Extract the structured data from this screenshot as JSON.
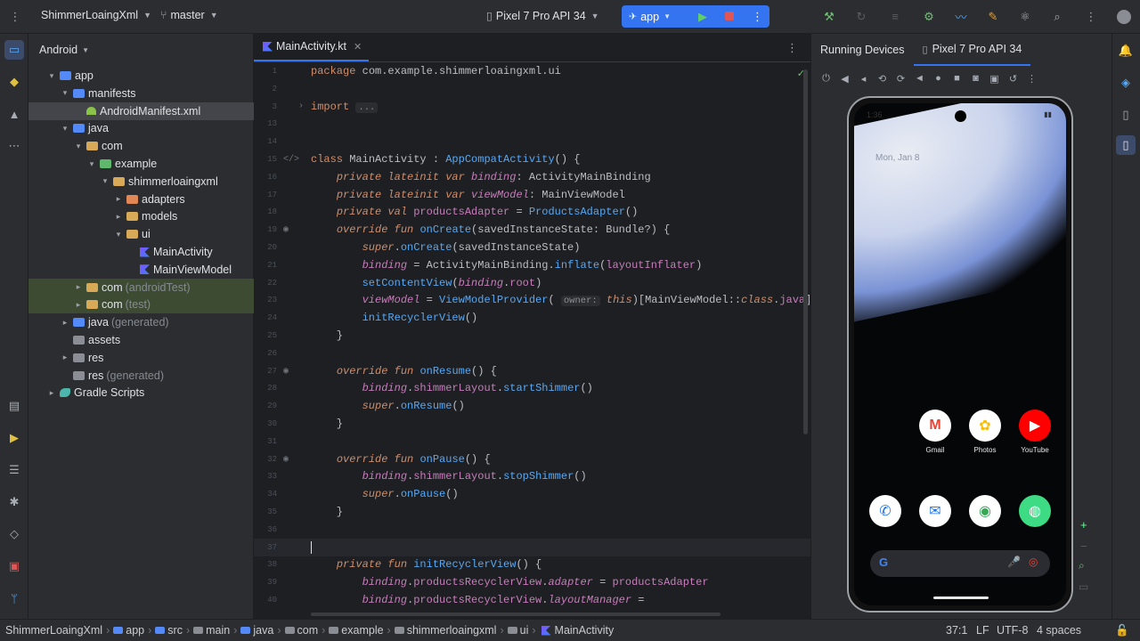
{
  "toolbar": {
    "project_name": "ShimmerLoaingXml",
    "branch": "master",
    "device": "Pixel 7 Pro API 34",
    "run_config": "app"
  },
  "project": {
    "view_mode": "Android",
    "tree": [
      {
        "label": "app",
        "extra": "",
        "depth": 1,
        "icon": "folder-blue",
        "caret": "▾"
      },
      {
        "label": "manifests",
        "extra": "",
        "depth": 2,
        "icon": "folder-blue",
        "caret": "▾"
      },
      {
        "label": "AndroidManifest.xml",
        "extra": "",
        "depth": 3,
        "icon": "android",
        "caret": ""
      },
      {
        "label": "java",
        "extra": "",
        "depth": 2,
        "icon": "folder-blue",
        "caret": "▾"
      },
      {
        "label": "com",
        "extra": "",
        "depth": 3,
        "icon": "folder",
        "caret": "▾"
      },
      {
        "label": "example",
        "extra": "",
        "depth": 4,
        "icon": "folder-green",
        "caret": "▾"
      },
      {
        "label": "shimmerloaingxml",
        "extra": "",
        "depth": 5,
        "icon": "folder",
        "caret": "▾"
      },
      {
        "label": "adapters",
        "extra": "",
        "depth": 6,
        "icon": "folder-orange",
        "caret": "▸"
      },
      {
        "label": "models",
        "extra": "",
        "depth": 6,
        "icon": "folder",
        "caret": "▸"
      },
      {
        "label": "ui",
        "extra": "",
        "depth": 6,
        "icon": "folder",
        "caret": "▾"
      },
      {
        "label": "MainActivity",
        "extra": "",
        "depth": 7,
        "icon": "kt",
        "caret": ""
      },
      {
        "label": "MainViewModel",
        "extra": "",
        "depth": 7,
        "icon": "kt",
        "caret": ""
      },
      {
        "label": "com",
        "extra": "(androidTest)",
        "depth": 3,
        "icon": "folder",
        "caret": "▸"
      },
      {
        "label": "com",
        "extra": "(test)",
        "depth": 3,
        "icon": "folder",
        "caret": "▸"
      },
      {
        "label": "java",
        "extra": "(generated)",
        "depth": 2,
        "icon": "folder-blue",
        "caret": "▸"
      },
      {
        "label": "assets",
        "extra": "",
        "depth": 2,
        "icon": "folder-gray",
        "caret": ""
      },
      {
        "label": "res",
        "extra": "",
        "depth": 2,
        "icon": "folder-gray",
        "caret": "▸"
      },
      {
        "label": "res",
        "extra": "(generated)",
        "depth": 2,
        "icon": "folder-gray",
        "caret": ""
      },
      {
        "label": "Gradle Scripts",
        "extra": "",
        "depth": 1,
        "icon": "gradle",
        "caret": "▸"
      }
    ]
  },
  "editor": {
    "tab_label": "MainActivity.kt",
    "lines": [
      {
        "n": "1",
        "html": "<span class='k'>package</span> com.example.shimmerloaingxml.ui"
      },
      {
        "n": "2",
        "html": ""
      },
      {
        "n": "3",
        "html": "<span class='k'>import</span> <span class='hint'>...</span>"
      },
      {
        "n": "13",
        "html": ""
      },
      {
        "n": "14",
        "html": ""
      },
      {
        "n": "15",
        "html": "<span class='k'>class</span> MainActivity : <span class='fn'>AppCompatActivity</span>() {"
      },
      {
        "n": "16",
        "html": "    <span class='ki'>private lateinit var</span> <span class='pvi'>binding</span>: ActivityMainBinding"
      },
      {
        "n": "17",
        "html": "    <span class='ki'>private lateinit var</span> <span class='pvi'>viewModel</span>: MainViewModel"
      },
      {
        "n": "18",
        "html": "    <span class='ki'>private val</span> <span class='pv'>productsAdapter</span> = <span class='fn'>ProductsAdapter</span>()"
      },
      {
        "n": "19",
        "html": "    <span class='ki'>override fun</span> <span class='fn'>onCreate</span>(savedInstanceState: Bundle?) {"
      },
      {
        "n": "20",
        "html": "        <span class='ki'>super</span>.<span class='fn'>onCreate</span>(savedInstanceState)"
      },
      {
        "n": "21",
        "html": "        <span class='pvi'>binding</span> = ActivityMainBinding.<span class='fn'>inflate</span>(<span class='pv'>layoutInflater</span>)"
      },
      {
        "n": "22",
        "html": "        <span class='fn'>setContentView</span>(<span class='pvi'>binding</span>.<span class='pv'>root</span>)"
      },
      {
        "n": "23",
        "html": "        <span class='pvi'>viewModel</span> = <span class='fn'>ViewModelProvider</span>( <span class='hint'>owner:</span> <span class='ki'>this</span>)[MainViewModel::<span class='ki'>class</span>.<span class='pv'>java</span>]"
      },
      {
        "n": "24",
        "html": "        <span class='fn'>initRecyclerView</span>()"
      },
      {
        "n": "25",
        "html": "    }"
      },
      {
        "n": "26",
        "html": ""
      },
      {
        "n": "27",
        "html": "    <span class='ki'>override fun</span> <span class='fn'>onResume</span>() {"
      },
      {
        "n": "28",
        "html": "        <span class='pvi'>binding</span>.<span class='pv'>shimmerLayout</span>.<span class='fn'>startShimmer</span>()"
      },
      {
        "n": "29",
        "html": "        <span class='ki'>super</span>.<span class='fn'>onResume</span>()"
      },
      {
        "n": "30",
        "html": "    }"
      },
      {
        "n": "31",
        "html": ""
      },
      {
        "n": "32",
        "html": "    <span class='ki'>override fun</span> <span class='fn'>onPause</span>() {"
      },
      {
        "n": "33",
        "html": "        <span class='pvi'>binding</span>.<span class='pv'>shimmerLayout</span>.<span class='fn'>stopShimmer</span>()"
      },
      {
        "n": "34",
        "html": "        <span class='ki'>super</span>.<span class='fn'>onPause</span>()"
      },
      {
        "n": "35",
        "html": "    }"
      },
      {
        "n": "36",
        "html": ""
      },
      {
        "n": "37",
        "html": ""
      },
      {
        "n": "38",
        "html": "    <span class='ki'>private fun</span> <span class='fn'>initRecyclerView</span>() {"
      },
      {
        "n": "39",
        "html": "        <span class='pvi'>binding</span>.<span class='pv'>productsRecyclerView</span>.<span class='pvi'>adapter</span> = <span class='pv'>productsAdapter</span>"
      },
      {
        "n": "40",
        "html": "        <span class='pvi'>binding</span>.<span class='pv'>productsRecyclerView</span>.<span class='pvi'>layoutManager</span> ="
      }
    ]
  },
  "device_panel": {
    "tab_running": "Running Devices",
    "tab_device": "Pixel 7 Pro API 34",
    "status_time": "1:36",
    "date_text": "Mon, Jan 8",
    "apps_row1": [
      {
        "label": "Gmail",
        "glyph": "M",
        "bg": "#ffffff",
        "fg": "#ea4335"
      },
      {
        "label": "Photos",
        "glyph": "✿",
        "bg": "#ffffff",
        "fg": "#fbbc04"
      },
      {
        "label": "YouTube",
        "glyph": "▶",
        "bg": "#ff0000",
        "fg": "#ffffff"
      }
    ],
    "apps_row2": [
      {
        "label": "",
        "glyph": "✆",
        "bg": "#ffffff",
        "fg": "#1a73e8"
      },
      {
        "label": "",
        "glyph": "✉",
        "bg": "#ffffff",
        "fg": "#1a73e8"
      },
      {
        "label": "",
        "glyph": "◉",
        "bg": "#ffffff",
        "fg": "#34a853"
      },
      {
        "label": "",
        "glyph": "◍",
        "bg": "#3ddc84",
        "fg": "#ffffff"
      }
    ]
  },
  "statusbar": {
    "crumbs": [
      "ShimmerLoaingXml",
      "app",
      "src",
      "main",
      "java",
      "com",
      "example",
      "shimmerloaingxml",
      "ui",
      "MainActivity"
    ],
    "position": "37:1",
    "line_sep": "LF",
    "encoding": "UTF-8",
    "indent": "4 spaces"
  }
}
